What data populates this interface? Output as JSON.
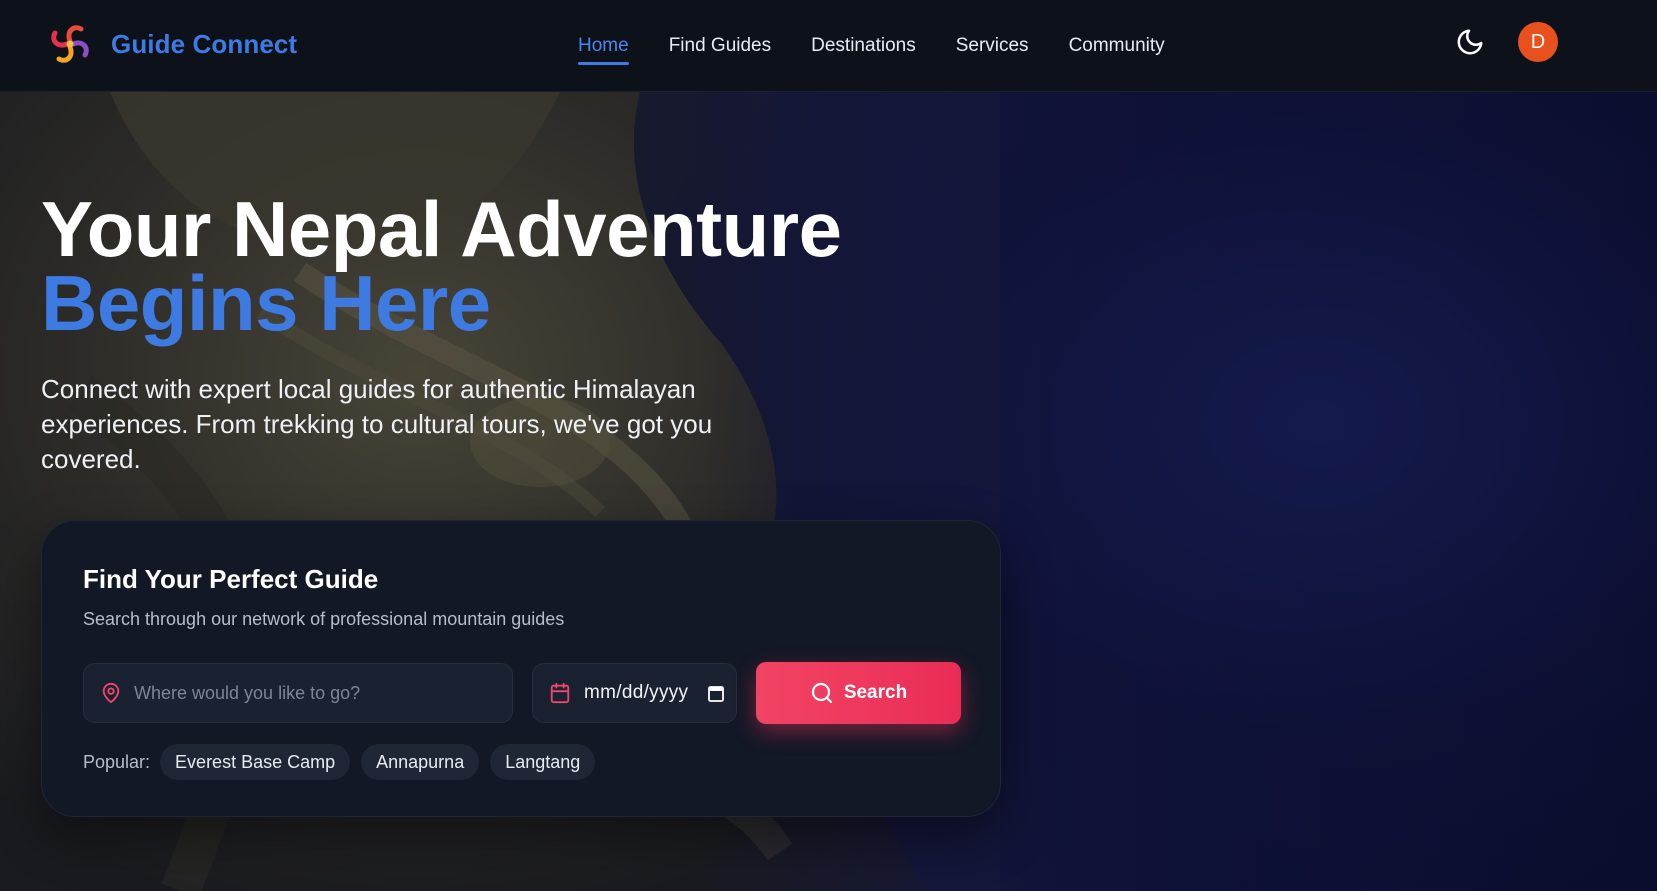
{
  "brand": {
    "name": "Guide Connect",
    "logo_icon": "spiral-logo-icon",
    "color": "#3d7be3"
  },
  "nav": {
    "items": [
      {
        "label": "Home",
        "active": true
      },
      {
        "label": "Find Guides",
        "active": false
      },
      {
        "label": "Destinations",
        "active": false
      },
      {
        "label": "Services",
        "active": false
      },
      {
        "label": "Community",
        "active": false
      }
    ],
    "theme_toggle_icon": "moon-icon",
    "avatar_initial": "D",
    "avatar_color": "#e8501d"
  },
  "hero": {
    "title_line1": "Your Nepal Adventure",
    "title_line2": "Begins Here",
    "subtitle": "Connect with expert local guides for authentic Himalayan experiences. From trekking to cultural tours, we've got you covered."
  },
  "search": {
    "title": "Find Your Perfect Guide",
    "subtitle": "Search through our network of professional mountain guides",
    "destination_placeholder": "Where would you like to go?",
    "date_value": "mm/dd/yyyy",
    "button_label": "Search",
    "button_color": "#ea2c55",
    "popular_label": "Popular:",
    "popular_items": [
      "Everest Base Camp",
      "Annapurna",
      "Langtang"
    ]
  }
}
